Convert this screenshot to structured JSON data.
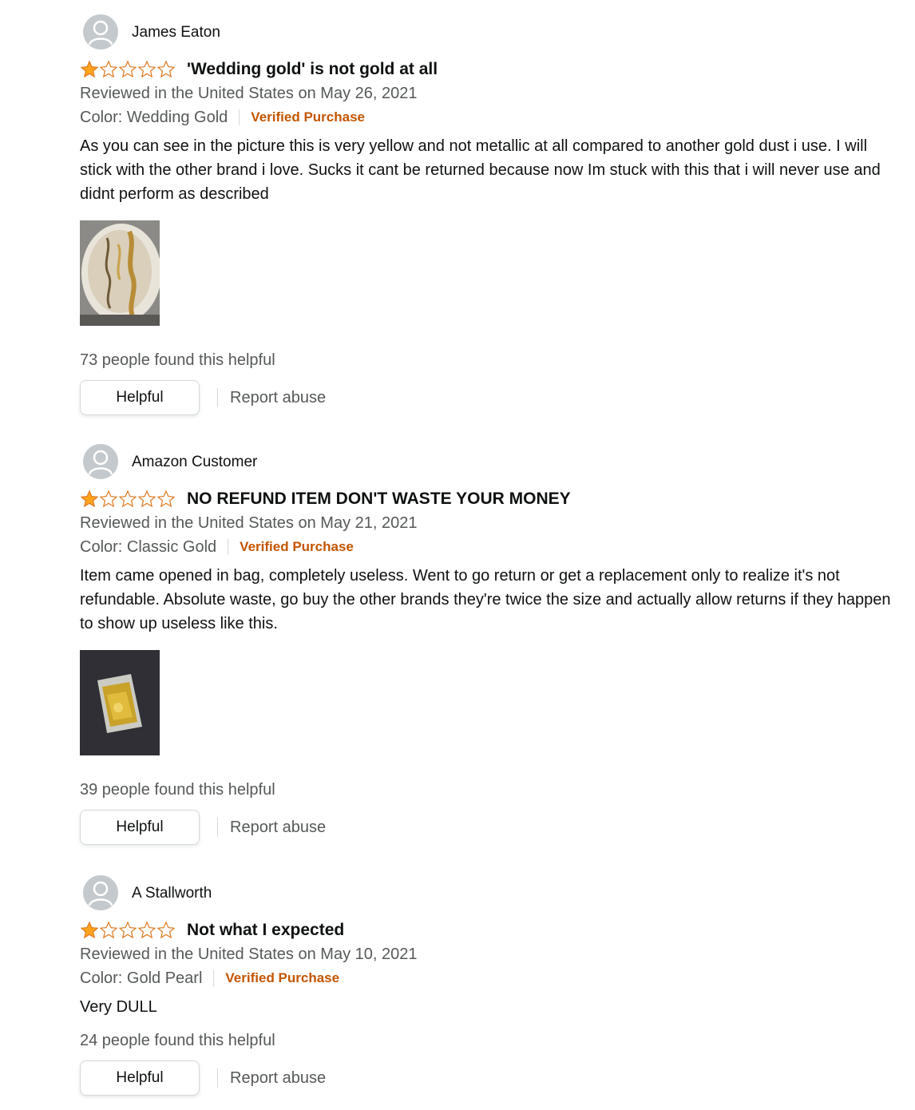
{
  "reviews": [
    {
      "profile_name": "James Eaton",
      "rating": 1,
      "rating_max": 5,
      "title": "'Wedding gold' is not gold at all",
      "date_text": "Reviewed in the United States on May 26, 2021",
      "color_text": "Color: Wedding Gold",
      "verified_label": "Verified Purchase",
      "body": "As you can see in the picture this is very yellow and not metallic at all compared to another gold dust i use. I will stick with the other brand i love. Sucks it cant be returned because now Im stuck with this that i will never use and didnt perform as described",
      "has_image": true,
      "helpful_text": "73 people found this helpful",
      "helpful_label": "Helpful",
      "report_label": "Report abuse"
    },
    {
      "profile_name": "Amazon Customer",
      "rating": 1,
      "rating_max": 5,
      "title": "NO REFUND ITEM DON'T WASTE YOUR MONEY",
      "date_text": "Reviewed in the United States on May 21, 2021",
      "color_text": "Color: Classic Gold",
      "verified_label": "Verified Purchase",
      "body": "Item came opened in bag, completely useless. Went to go return or get a replacement only to realize it's not refundable. Absolute waste, go buy the other brands they're twice the size and actually allow returns if they happen to show up useless like this.",
      "has_image": true,
      "helpful_text": "39 people found this helpful",
      "helpful_label": "Helpful",
      "report_label": "Report abuse"
    },
    {
      "profile_name": "A Stallworth",
      "rating": 1,
      "rating_max": 5,
      "title": "Not what I expected",
      "date_text": "Reviewed in the United States on May 10, 2021",
      "color_text": "Color: Gold Pearl",
      "verified_label": "Verified Purchase",
      "body": "Very DULL",
      "has_image": false,
      "helpful_text": "24 people found this helpful",
      "helpful_label": "Helpful",
      "report_label": "Report abuse"
    }
  ],
  "colors": {
    "star_filled": "#ffa41c",
    "star_outline": "#de7921",
    "verified": "#c45500",
    "muted_text": "#565959",
    "avatar_bg": "#c3c9cc"
  },
  "icons": {
    "avatar": "default-profile-avatar-icon",
    "star_filled": "star-filled-icon",
    "star_empty": "star-empty-icon"
  }
}
